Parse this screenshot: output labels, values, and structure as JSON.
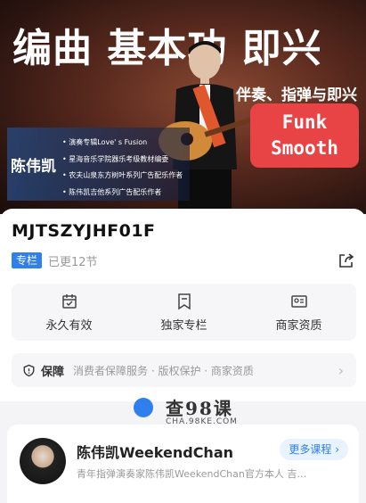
{
  "banner": {
    "title": "编曲 基本功 即兴",
    "subtitle": "伴奏、指弹与即兴",
    "funk_line1": "Funk",
    "funk_line2": "Smooth",
    "teacher_name": "陈伟凯",
    "credits": [
      "演奏专辑Love' s Fusion",
      "星海音乐学院器乐考级教材编委",
      "农夫山泉东方树叶系列广告配乐作者",
      "陈伟凯吉他系列广告配乐作者"
    ]
  },
  "product": {
    "code": "MJTSZYJHF01F",
    "tag": "专栏",
    "updated": "已更12节"
  },
  "features": [
    {
      "label": "永久有效",
      "icon": "calendar-check-icon"
    },
    {
      "label": "独家专栏",
      "icon": "bookmark-icon"
    },
    {
      "label": "商家资质",
      "icon": "id-card-icon"
    }
  ],
  "guarantee": {
    "title": "保障",
    "desc": "消费者保障服务 · 版权保护 · 商家资质"
  },
  "watermark": {
    "text": "查98课",
    "url": "CHA.98KE.COM"
  },
  "author": {
    "name": "陈伟凯WeekendChan",
    "more_label": "更多课程 ›",
    "desc": "青年指弹演奏家陈伟凯WeekendChan官方本人 吉…"
  },
  "colors": {
    "accent": "#2f80ed",
    "funk_red": "#e84446"
  }
}
